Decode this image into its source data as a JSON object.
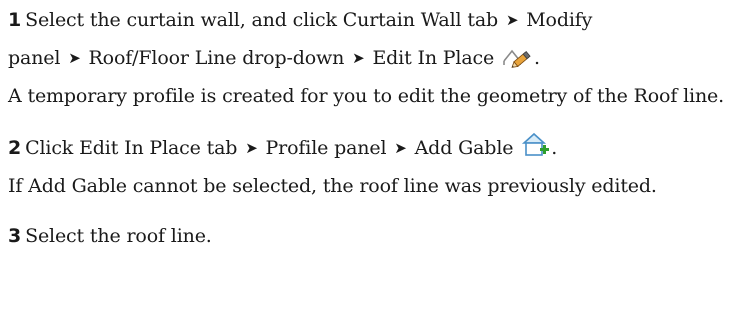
{
  "steps": [
    {
      "number": "1",
      "line1": {
        "t1": "Select the curtain wall, and click Curtain Wall tab",
        "t2": "Modify"
      },
      "line2": {
        "t1": "panel",
        "t2": "Roof/Floor Line drop-down",
        "t3": "Edit In Place",
        "end": "."
      },
      "note": "A temporary profile is created for you to edit the geometry of the Roof line.",
      "icon": "edit-in-place-icon"
    },
    {
      "number": "2",
      "line1": {
        "t1": "Click Edit In Place tab ",
        "t2": "Profile panel",
        "t3": "Add Gable",
        "end": "."
      },
      "note": "If Add Gable cannot be selected, the roof line was previously edited.",
      "icon": "add-gable-icon"
    },
    {
      "number": "3",
      "text": "Select the roof line."
    }
  ],
  "arrow_glyph": "➤",
  "colors": {
    "text": "#1a1a1a",
    "pencil": "#e8a33a",
    "green_plus": "#2e9e2e",
    "house_blue": "#4a90c8"
  }
}
